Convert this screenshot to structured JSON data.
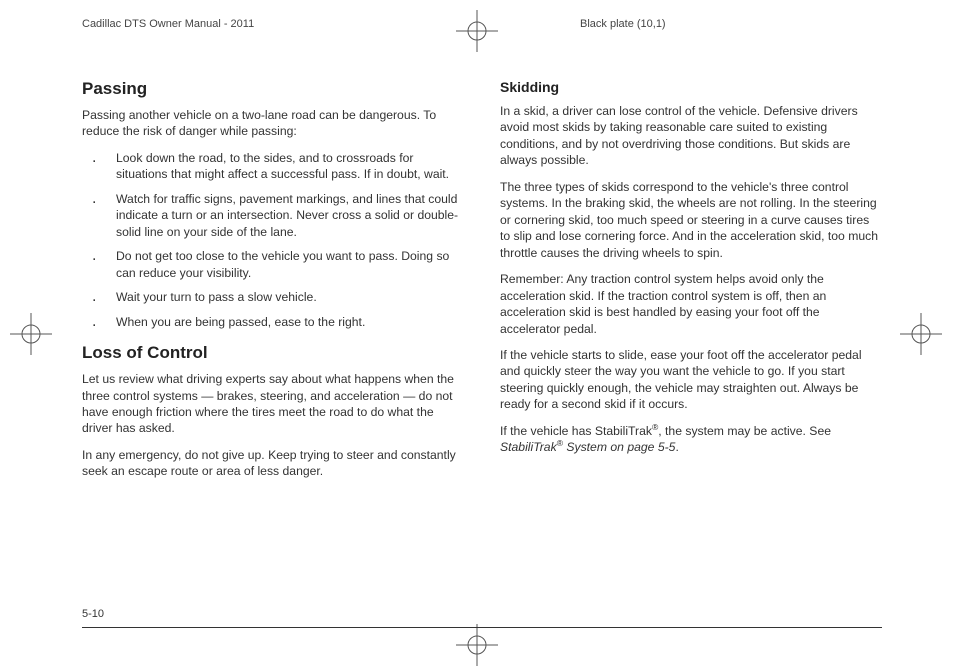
{
  "header": {
    "left": "Cadillac DTS Owner Manual - 2011",
    "right": "Black plate (10,1)"
  },
  "footer": {
    "page": "5-10"
  },
  "left_col": {
    "h_passing": "Passing",
    "p_passing_intro": "Passing another vehicle on a two-lane road can be dangerous. To reduce the risk of danger while passing:",
    "bullets": [
      "Look down the road, to the sides, and to crossroads for situations that might affect a successful pass. If in doubt, wait.",
      "Watch for traffic signs, pavement markings, and lines that could indicate a turn or an intersection. Never cross a solid or double-solid line on your side of the lane.",
      "Do not get too close to the vehicle you want to pass. Doing so can reduce your visibility.",
      "Wait your turn to pass a slow vehicle.",
      "When you are being passed, ease to the right."
    ],
    "h_loss": "Loss of Control",
    "p_loss_1": "Let us review what driving experts say about what happens when the three control systems — brakes, steering, and acceleration — do not have enough friction where the tires meet the road to do what the driver has asked.",
    "p_loss_2": "In any emergency, do not give up. Keep trying to steer and constantly seek an escape route or area of less danger."
  },
  "right_col": {
    "h_skidding": "Skidding",
    "p1": "In a skid, a driver can lose control of the vehicle. Defensive drivers avoid most skids by taking reasonable care suited to existing conditions, and by not overdriving those conditions. But skids are always possible.",
    "p2": "The three types of skids correspond to the vehicle's three control systems. In the braking skid, the wheels are not rolling. In the steering or cornering skid, too much speed or steering in a curve causes tires to slip and lose cornering force. And in the acceleration skid, too much throttle causes the driving wheels to spin.",
    "p3": "Remember: Any traction control system helps avoid only the acceleration skid. If the traction control system is off, then an acceleration skid is best handled by easing your foot off the accelerator pedal.",
    "p4": "If the vehicle starts to slide, ease your foot off the accelerator pedal and quickly steer the way you want the vehicle to go. If you start steering quickly enough, the vehicle may straighten out. Always be ready for a second skid if it occurs.",
    "p5a": "If the vehicle has StabiliTrak",
    "p5b": ", the system may be active. See ",
    "p5c_ital_a": "StabiliTrak",
    "p5c_ital_b": " System on page 5-5",
    "p5d": "."
  }
}
